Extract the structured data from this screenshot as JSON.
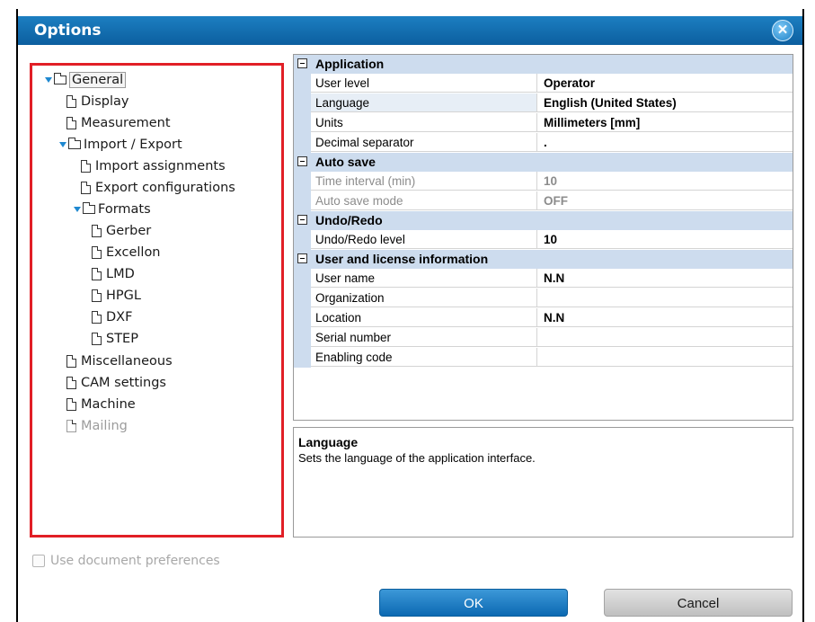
{
  "window": {
    "title": "Options",
    "close_glyph": "✕"
  },
  "tree": [
    {
      "label": "General",
      "type": "folder",
      "expanded": true,
      "selected": true
    },
    {
      "label": "Display",
      "type": "doc"
    },
    {
      "label": "Measurement",
      "type": "doc"
    },
    {
      "label": "Import / Export",
      "type": "folder",
      "expanded": true
    },
    {
      "label": "Import assignments",
      "type": "doc"
    },
    {
      "label": "Export configurations",
      "type": "doc"
    },
    {
      "label": "Formats",
      "type": "folder",
      "expanded": true
    },
    {
      "label": "Gerber",
      "type": "doc"
    },
    {
      "label": "Excellon",
      "type": "doc"
    },
    {
      "label": "LMD",
      "type": "doc"
    },
    {
      "label": "HPGL",
      "type": "doc"
    },
    {
      "label": "DXF",
      "type": "doc"
    },
    {
      "label": "STEP",
      "type": "doc"
    },
    {
      "label": "Miscellaneous",
      "type": "doc"
    },
    {
      "label": "CAM settings",
      "type": "doc"
    },
    {
      "label": "Machine",
      "type": "doc"
    },
    {
      "label": "Mailing",
      "type": "doc",
      "disabled": true
    }
  ],
  "property_grid": {
    "sections": [
      {
        "title": "Application",
        "rows": [
          {
            "name": "User level",
            "value": "Operator"
          },
          {
            "name": "Language",
            "value": "English (United States)",
            "selected": true
          },
          {
            "name": "Units",
            "value": "Millimeters [mm]"
          },
          {
            "name": "Decimal separator",
            "value": "."
          }
        ]
      },
      {
        "title": "Auto save",
        "rows": [
          {
            "name": "Time interval (min)",
            "value": "10",
            "disabled": true
          },
          {
            "name": "Auto save mode",
            "value": "OFF",
            "disabled": true
          }
        ]
      },
      {
        "title": "Undo/Redo",
        "rows": [
          {
            "name": "Undo/Redo level",
            "value": "10"
          }
        ]
      },
      {
        "title": "User and license information",
        "rows": [
          {
            "name": "User name",
            "value": "N.N"
          },
          {
            "name": "Organization",
            "value": ""
          },
          {
            "name": "Location",
            "value": "N.N"
          },
          {
            "name": "Serial number",
            "value": ""
          },
          {
            "name": "Enabling code",
            "value": ""
          }
        ]
      }
    ]
  },
  "description": {
    "title": "Language",
    "text": "Sets the language of the application interface."
  },
  "footer": {
    "use_document_preferences": "Use document preferences",
    "ok_label": "OK",
    "cancel_label": "Cancel"
  },
  "colors": {
    "titlebar": "#0c5f9f",
    "highlight_border": "#e11f26",
    "grid_header": "#cddcee",
    "ok_button": "#0c69b2"
  }
}
